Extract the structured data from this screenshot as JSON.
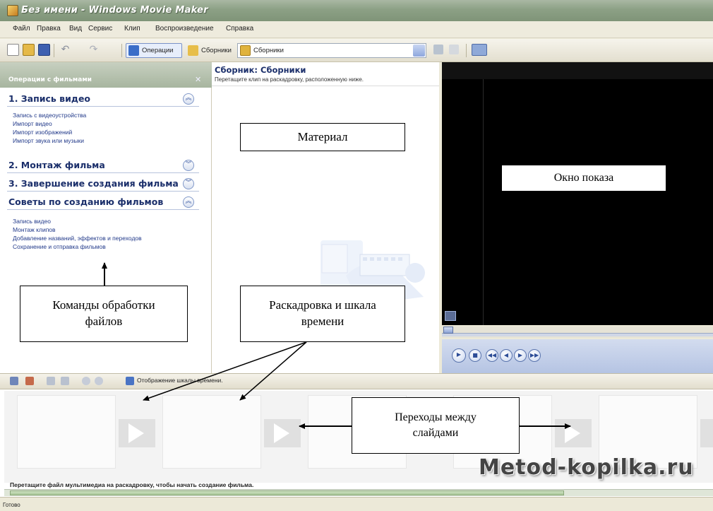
{
  "window": {
    "title": "Без имени - Windows Movie Maker"
  },
  "menu": [
    "Файл",
    "Правка",
    "Вид",
    "Сервис",
    "Клип",
    "Воспроизведение",
    "Справка"
  ],
  "toolbar": {
    "tasks_label": "Операции",
    "collections_label": "Сборники",
    "collection_select": "Сборники"
  },
  "taskpane": {
    "header": "Операции с фильмами",
    "sections": [
      {
        "title": "1. Запись видео",
        "expanded": true,
        "items": [
          "Запись с видеоустройства",
          "Импорт видео",
          "Импорт изображений",
          "Импорт звука или музыки"
        ]
      },
      {
        "title": "2. Монтаж фильма",
        "expanded": false,
        "items": []
      },
      {
        "title": "3. Завершение создания фильма",
        "expanded": false,
        "items": []
      },
      {
        "title": "Советы по созданию фильмов",
        "expanded": true,
        "items": [
          "Запись видео",
          "Монтаж клипов",
          "Добавление названий, эффектов и переходов",
          "Сохранение и отправка фильмов"
        ]
      }
    ]
  },
  "collection": {
    "title": "Сборник: Сборники",
    "hint": "Перетащите клип на раскадровку, расположенную ниже."
  },
  "storyboard": {
    "toolbar_label": "Отображение шкалы времени.",
    "hint": "Перетащите файл мультимедиа на раскадровку, чтобы начать создание фильма."
  },
  "status": {
    "text": "Готово"
  },
  "callouts": {
    "material": "Материал",
    "preview": "Окно показа",
    "commands": "Команды обработки\nфайлов",
    "storyboard": "Раскадровка и шкала\nвремени",
    "transitions": "Переходы между\nслайдами"
  },
  "watermark": "Metod-kopilka.ru"
}
